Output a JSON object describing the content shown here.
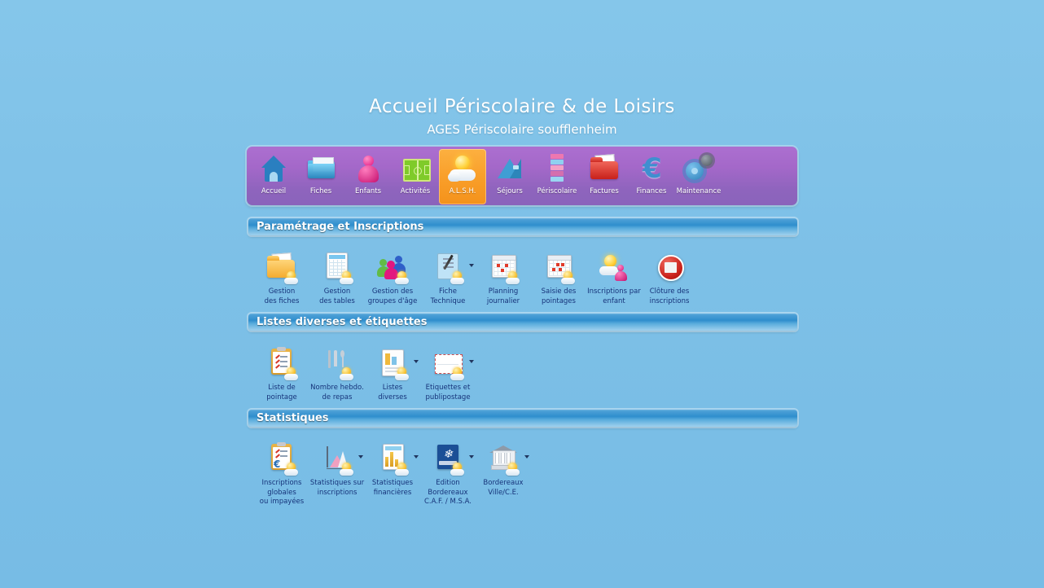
{
  "window": {
    "title": "Accueil Périscolaire & de Loisirs",
    "subtitle": "AGES Périscolaire soufflenheim",
    "background_color": "#7ec2e8",
    "toolbar_color": "#a468c9",
    "active_tab_color": "#f99f2a",
    "section_bar_color": "#2f8ecd",
    "caption_color": "#16337a"
  },
  "toolbar": {
    "items": [
      {
        "label": "Accueil",
        "icon": "home-icon",
        "active": false
      },
      {
        "label": "Fiches",
        "icon": "folder-icon",
        "active": false
      },
      {
        "label": "Enfants",
        "icon": "child-icon",
        "active": false
      },
      {
        "label": "Activités",
        "icon": "sportsfield-icon",
        "active": false
      },
      {
        "label": "A.L.S.H.",
        "icon": "sun-cloud-icon",
        "active": true
      },
      {
        "label": "Séjours",
        "icon": "tent-icon",
        "active": false
      },
      {
        "label": "Périscolaire",
        "icon": "blocks-icon",
        "active": false
      },
      {
        "label": "Factures",
        "icon": "red-folder-icon",
        "active": false
      },
      {
        "label": "Finances",
        "icon": "euro-icon",
        "active": false
      },
      {
        "label": "Maintenance",
        "icon": "gears-icon",
        "active": false
      }
    ]
  },
  "sections": [
    {
      "title": "Paramétrage et Inscriptions",
      "items": [
        {
          "label": "Gestion\ndes fiches",
          "icon": "folder-doc-icon",
          "dropdown": false
        },
        {
          "label": "Gestion\ndes tables",
          "icon": "table-sheet-icon",
          "dropdown": false
        },
        {
          "label": "Gestion des\ngroupes d'âge",
          "icon": "people-group-icon",
          "dropdown": false
        },
        {
          "label": "Fiche\nTechnique",
          "icon": "tech-sheet-icon",
          "dropdown": true
        },
        {
          "label": "Planning\njournalier",
          "icon": "calendar-icon",
          "dropdown": false
        },
        {
          "label": "Saisie des\npointages",
          "icon": "calendar-entry-icon",
          "dropdown": false
        },
        {
          "label": "Inscriptions par\nenfant",
          "icon": "sun-child-icon",
          "dropdown": false
        },
        {
          "label": "Clôture des\ninscriptions",
          "icon": "stop-icon",
          "dropdown": false
        }
      ]
    },
    {
      "title": "Listes diverses et étiquettes",
      "items": [
        {
          "label": "Liste de\npointage",
          "icon": "clipboard-icon",
          "dropdown": false
        },
        {
          "label": "Nombre hebdo.\nde repas",
          "icon": "cutlery-icon",
          "dropdown": false
        },
        {
          "label": "Listes\ndiverses",
          "icon": "list-doc-icon",
          "dropdown": true
        },
        {
          "label": "Etiquettes et\npublipostage",
          "icon": "envelope-icon",
          "dropdown": true
        }
      ]
    },
    {
      "title": "Statistiques",
      "items": [
        {
          "label": "Inscriptions\nglobales\nou impayées",
          "icon": "clipboard-euro-icon",
          "dropdown": false
        },
        {
          "label": "Statistiques sur\ninscriptions",
          "icon": "chart-icon",
          "dropdown": true
        },
        {
          "label": "Statistiques\nfinancières",
          "icon": "bar-chart-doc-icon",
          "dropdown": true
        },
        {
          "label": "Edition\nBordereaux\nC.A.F. / M.S.A.",
          "icon": "caf-logo-icon",
          "dropdown": true
        },
        {
          "label": "Bordereaux\nVille/C.E.",
          "icon": "townhall-icon",
          "dropdown": true
        }
      ]
    }
  ]
}
